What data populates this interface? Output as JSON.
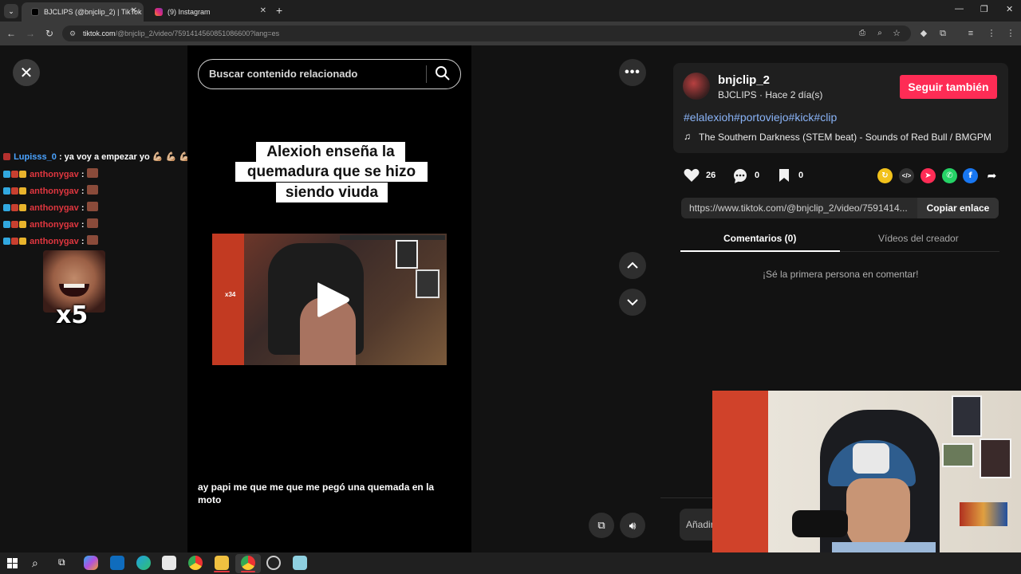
{
  "browser": {
    "tabs": [
      {
        "title": "BJCLIPS (@bnjclip_2) | TikTok",
        "active": true
      },
      {
        "title": "(9) Instagram",
        "active": false
      }
    ],
    "url_host": "tiktok.com",
    "url_path": "/@bnjclip_2/video/7591414560851086600?lang=es"
  },
  "video": {
    "search_placeholder": "Buscar contenido relacionado",
    "caption_lines": [
      "Alexioh enseña la",
      "quemadura que se hizo",
      "siendo viuda"
    ],
    "subtitle": "ay papi me que me que me pegó una quemada en la moto",
    "thumb_overlay_text": "x34"
  },
  "chat": {
    "lines": [
      {
        "name": "Lupisss_0",
        "message": ": ya voy a empezar yo 💪🏼 💪🏼 💪🏼 💪🏼",
        "name_color": "#4aa3ff"
      },
      {
        "name": "anthonygav",
        "message": ":",
        "name_color": "#e0363f"
      },
      {
        "name": "anthonygav",
        "message": ":",
        "name_color": "#e0363f"
      },
      {
        "name": "anthonygav",
        "message": ":",
        "name_color": "#e0363f"
      },
      {
        "name": "anthonygav",
        "message": ":",
        "name_color": "#e0363f"
      },
      {
        "name": "anthonygav",
        "message": ":",
        "name_color": "#e0363f"
      }
    ],
    "emote_multiplier": "x5"
  },
  "author": {
    "username": "bnjclip_2",
    "subline": "BJCLIPS · Hace 2 día(s)",
    "follow_label": "Seguir también",
    "hashtags": "#elalexioh#portoviejo#kick#clip",
    "music": "The Southern Darkness (STEM beat) - Sounds of Red Bull / BMGPM"
  },
  "stats": {
    "likes": "26",
    "comments": "0",
    "saves": "0"
  },
  "share": {
    "link": "https://www.tiktok.com/@bnjclip_2/video/7591414...",
    "copy_label": "Copiar enlace"
  },
  "tabs": {
    "comments": "Comentarios (0)",
    "creator_videos": "Vídeos del creador"
  },
  "comments_empty": "¡Sé la primera persona en comentar!",
  "add_comment_placeholder": "Añadir",
  "colors": {
    "accent": "#fe2c55",
    "hashtag": "#8ab4f8",
    "chat_name": "#e0363f"
  }
}
